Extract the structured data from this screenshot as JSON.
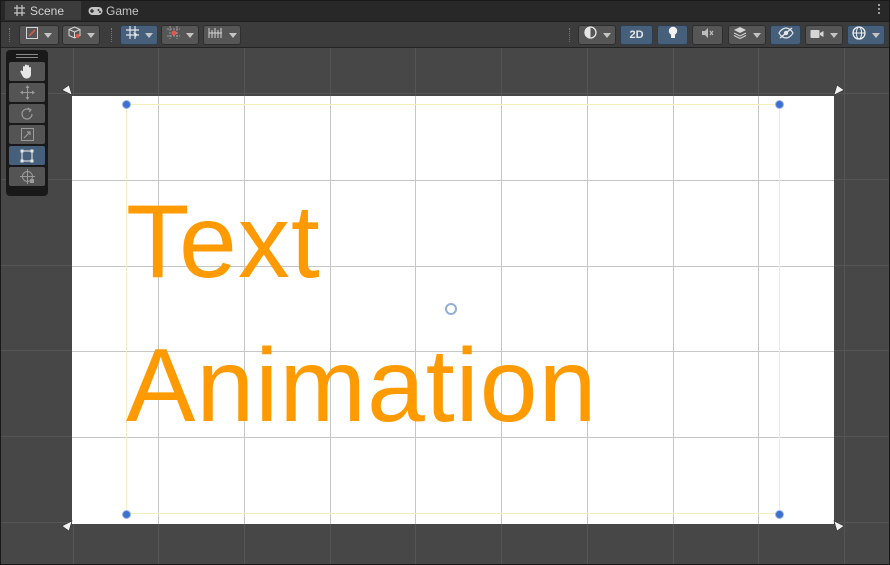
{
  "tabs": [
    {
      "label": "Scene",
      "icon": "hash-icon",
      "active": true
    },
    {
      "label": "Game",
      "icon": "gamepad-icon",
      "active": false
    }
  ],
  "toolbar": {
    "draw_mode_icon": "draw-mode-icon",
    "gizmo_icon": "cube-icon",
    "grid_snap_icon": "grid-snap-icon",
    "increment_snap_icon": "increment-snap-icon",
    "ruler_icon": "ruler-icon",
    "shading_icon": "shading-icon",
    "mode_2d_label": "2D",
    "lighting_icon": "light-bulb-icon",
    "audio_icon": "audio-mute-icon",
    "effects_icon": "layers-icon",
    "visibility_icon": "hidden-eye-icon",
    "camera_icon": "camera-icon",
    "gizmos_icon": "gizmo-globe-icon"
  },
  "tools": [
    {
      "name": "hand-tool",
      "icon": "hand-icon",
      "active": false
    },
    {
      "name": "move-tool",
      "icon": "move-arrows-icon",
      "active": false
    },
    {
      "name": "rotate-tool",
      "icon": "rotate-icon",
      "active": false
    },
    {
      "name": "scale-tool",
      "icon": "scale-icon",
      "active": false
    },
    {
      "name": "rect-tool",
      "icon": "rect-transform-icon",
      "active": true
    },
    {
      "name": "transform-tool",
      "icon": "transform-icon",
      "active": false
    }
  ],
  "scene": {
    "text_object": "Text\nAnimation",
    "text_color": "#ff9a00",
    "canvas_color": "#ffffff",
    "handle_color": "#3d6fcf"
  },
  "colors": {
    "active_button": "#46607c",
    "background": "#474747"
  }
}
